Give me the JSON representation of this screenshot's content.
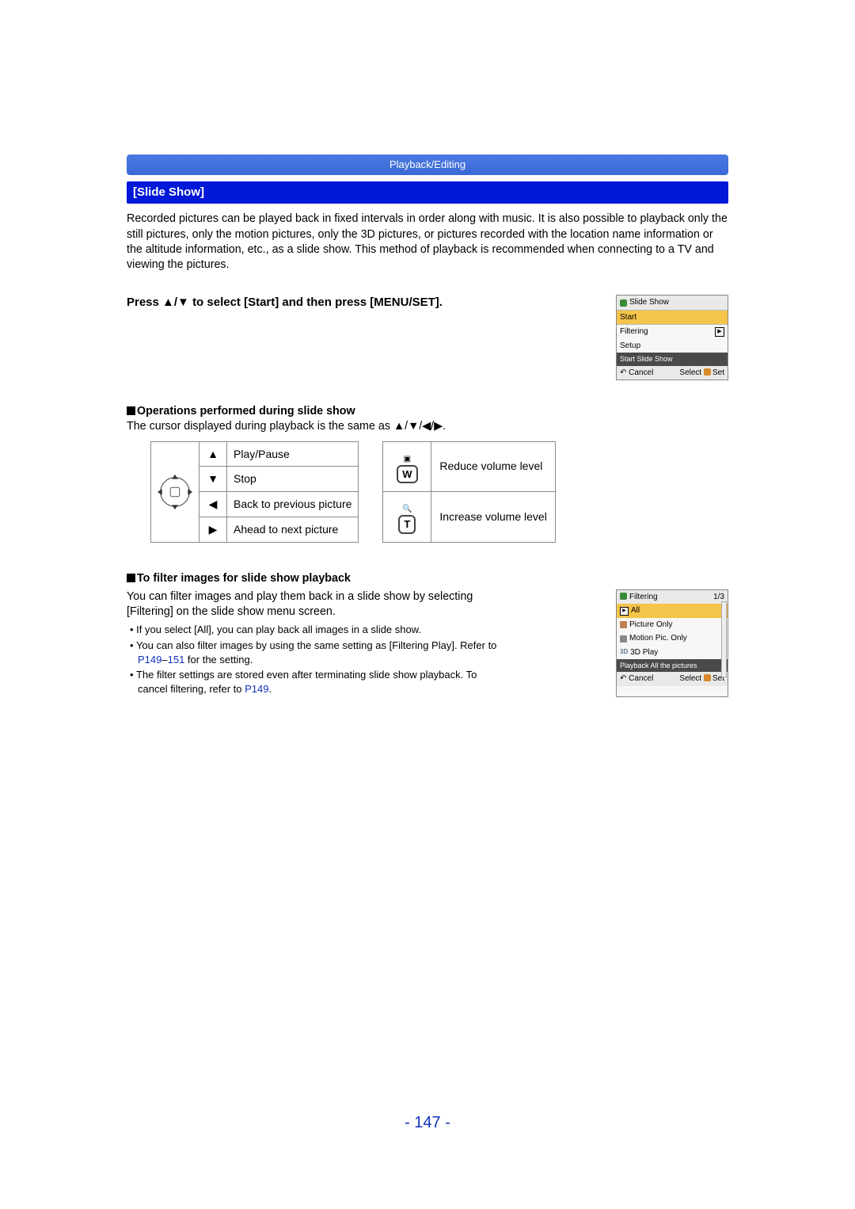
{
  "breadcrumb": "Playback/Editing",
  "section_title": "[Slide Show]",
  "intro_paragraph": "Recorded pictures can be played back in fixed intervals in order along with music. It is also possible to playback only the still pictures, only the motion pictures, only the 3D pictures, or pictures recorded with the location name information or the altitude information, etc., as a slide show. This method of playback is recommended when connecting to a TV and viewing the pictures.",
  "instruction_line": "Press ▲/▼ to select [Start] and then press [MENU/SET].",
  "slide_menu": {
    "title": "Slide Show",
    "selected": "Start",
    "items": [
      "Filtering",
      "Setup"
    ],
    "status_bar": "Start Slide Show",
    "cancel": "Cancel",
    "select": "Select",
    "set": "Set"
  },
  "ops_heading": "Operations performed during slide show",
  "ops_line": "The cursor displayed during playback is the same as ▲/▼/◀/▶.",
  "dpad_actions": {
    "up": "Play/Pause",
    "down": "Stop",
    "left": "Back to previous picture",
    "right": "Ahead to next picture"
  },
  "zoom_actions": {
    "w": "Reduce volume level",
    "t": "Increase volume level",
    "w_key": "W",
    "t_key": "T"
  },
  "filter_heading": "To filter images for slide show playback",
  "filter_paragraph": "You can filter images and play them back in a slide show by selecting [Filtering] on the slide show menu screen.",
  "filter_bullets": {
    "b1": "If you select [All], you can play back all images in a slide show.",
    "b2_pre": "You can also filter images by using the same setting as [Filtering Play]. Refer to ",
    "b2_link1": "P149",
    "b2_dash": "–",
    "b2_link2": "151",
    "b2_post": " for the setting.",
    "b3_pre": "The filter settings are stored even after terminating slide show playback. To cancel filtering, refer to ",
    "b3_link": "P149",
    "b3_post": "."
  },
  "filter_menu": {
    "title": "Filtering",
    "page": "1/3",
    "selected": "All",
    "items": [
      "Picture Only",
      "Motion Pic. Only",
      "3D Play"
    ],
    "status_bar": "Playback All the pictures",
    "cancel": "Cancel",
    "select": "Select",
    "set": "Set"
  },
  "arrows": {
    "up": "▲",
    "down": "▼",
    "left": "◀",
    "right": "▶",
    "return": "↶",
    "search": "🔍",
    "box": "▣"
  },
  "page_number": "- 147 -"
}
